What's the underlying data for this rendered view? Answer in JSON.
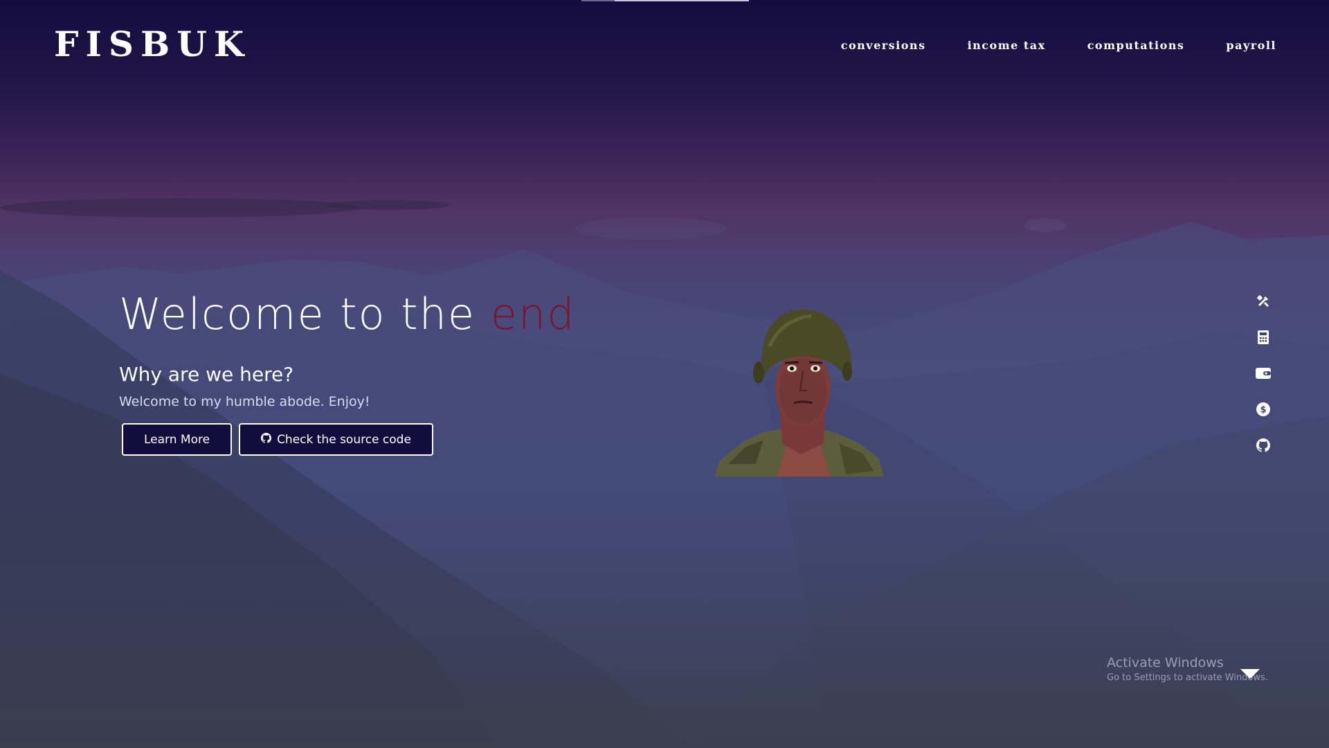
{
  "brand": {
    "logo": "FISBUK"
  },
  "nav": {
    "items": [
      {
        "label": "conversions"
      },
      {
        "label": "income tax"
      },
      {
        "label": "computations"
      },
      {
        "label": "payroll"
      }
    ]
  },
  "hero": {
    "title_prefix": "Welcome to the ",
    "title_accent": "end",
    "subtitle": "Why are we here?",
    "text": "Welcome to my humble abode. Enjoy!",
    "learn_more_label": "Learn More",
    "source_code_label": "Check the source code"
  },
  "side_icons": [
    {
      "icon": "tools-icon"
    },
    {
      "icon": "calculator-icon"
    },
    {
      "icon": "wallet-icon"
    },
    {
      "icon": "dollar-coin-icon"
    },
    {
      "icon": "github-icon"
    }
  ],
  "windows_watermark": {
    "line1": "Activate Windows",
    "line2": "Go to Settings to activate Windows."
  },
  "colors": {
    "accent": "#7a1530",
    "button_bg": "#130d3e",
    "header_bg": "#130c3f"
  }
}
